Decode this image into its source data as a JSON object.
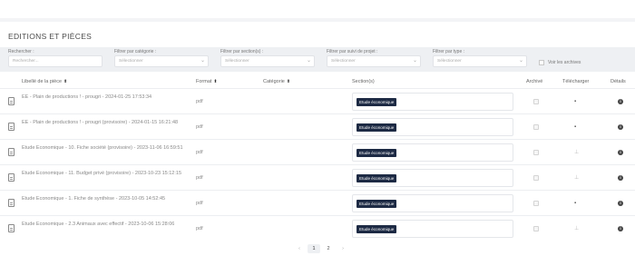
{
  "page": {
    "title": "EDITIONS ET PIÈCES"
  },
  "filters": {
    "search": {
      "label": "Rechercher :",
      "placeholder": "Rechercher..."
    },
    "category": {
      "label": "Filtrer par catégorie :",
      "value": "Sélectionner"
    },
    "section": {
      "label": "Filtrer par section(s) :",
      "value": "Sélectionner"
    },
    "project": {
      "label": "Filtrer par suivi de projet :",
      "value": "Sélectionner"
    },
    "type": {
      "label": "Filtrer par type :",
      "value": "Sélectionner"
    },
    "archives": {
      "label": "Voir les archives"
    }
  },
  "table": {
    "headers": {
      "libelle": "Libellé de la pièce",
      "format": "Format",
      "categorie": "Catégorie",
      "sections": "Section(s)",
      "archive": "Archivé",
      "telecharger": "Télécharger",
      "details": "Détails"
    },
    "rows": [
      {
        "libelle": "EE - Plain de productions ! - prougri - 2024-01-25 17:53:34",
        "format": "pdf",
        "section": "Etude économique",
        "download_icon": "save-icon"
      },
      {
        "libelle": "EE - Plain de productions ! - prougri (provisoire) - 2024-01-15 16:21:48",
        "format": "pdf",
        "section": "Etude économique",
        "download_icon": "save-icon"
      },
      {
        "libelle": "Etude Economique - 10. Fiche société (provisoire) - 2023-11-06 16:59:51",
        "format": "pdf",
        "section": "Etude économique",
        "download_icon": "dim-download-icon"
      },
      {
        "libelle": "Etude Economique - 11. Budget privé (provisoire) - 2023-10-23 15:12:15",
        "format": "pdf",
        "section": "Etude économique",
        "download_icon": "dim-download-icon"
      },
      {
        "libelle": "Etude Economique - 1. Fiche de synthèse - 2023-10-05 14:52:45",
        "format": "pdf",
        "section": "Etude économique",
        "download_icon": "save-icon"
      },
      {
        "libelle": "Etude Economique - 2.3 Animaux avec effectif - 2023-10-06 15:28:06",
        "format": "pdf",
        "section": "Etude économique",
        "download_icon": "dim-download-icon"
      }
    ]
  },
  "pagination": {
    "prev": "‹",
    "pages": [
      "1",
      "2"
    ],
    "next": "›"
  },
  "colors": {
    "badge": "#1d2a44",
    "filterbar": "#eef0f3"
  }
}
